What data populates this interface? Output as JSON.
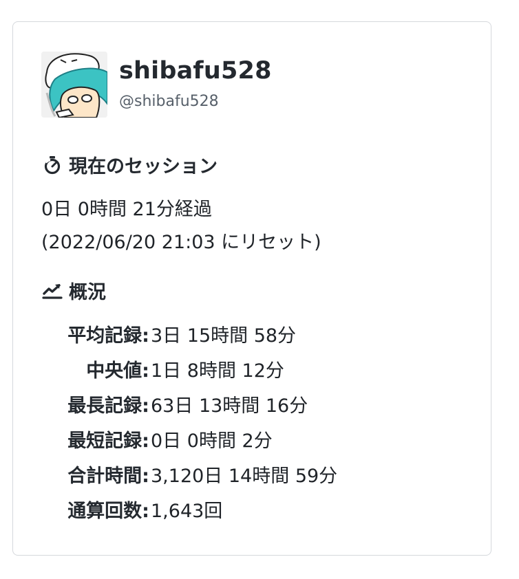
{
  "profile": {
    "display_name": "shibafu528",
    "handle": "@shibafu528"
  },
  "session": {
    "heading": "現在のセッション",
    "elapsed": "0日 0時間 21分経過",
    "reset_note": "(2022/06/20 21:03 にリセット)"
  },
  "overview": {
    "heading": "概況",
    "stats": [
      {
        "label": "平均記録:",
        "value": "3日 15時間 58分"
      },
      {
        "label": "中央値:",
        "value": "1日 8時間 12分"
      },
      {
        "label": "最長記録:",
        "value": "63日 13時間 16分"
      },
      {
        "label": "最短記録:",
        "value": "0日 0時間 2分"
      },
      {
        "label": "合計時間:",
        "value": "3,120日 14時間 59分"
      },
      {
        "label": "通算回数:",
        "value": "1,643回"
      }
    ]
  },
  "icons": {
    "session": "stopwatch-icon",
    "overview": "trend-chart-icon"
  },
  "colors": {
    "avatar_hair": "#3cc3c3",
    "avatar_bg": "#f1f1f1",
    "text_primary": "#24292f",
    "text_muted": "#57606a",
    "border": "#d5d8dc"
  }
}
